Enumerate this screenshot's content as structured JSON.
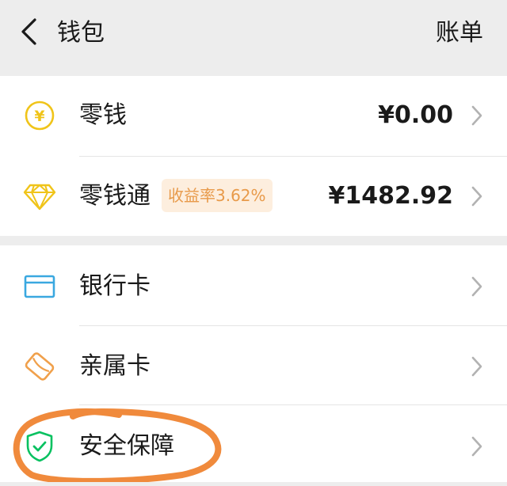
{
  "header": {
    "title": "钱包",
    "action": "账单"
  },
  "balance_group": [
    {
      "label": "零钱",
      "value": "¥0.00",
      "icon": "coin-icon"
    },
    {
      "label": "零钱通",
      "badge": "收益率3.62%",
      "value": "¥1482.92",
      "icon": "diamond-icon"
    }
  ],
  "services_group": [
    {
      "label": "银行卡",
      "icon": "bank-card-icon"
    },
    {
      "label": "亲属卡",
      "icon": "family-card-icon"
    },
    {
      "label": "安全保障",
      "icon": "shield-check-icon"
    }
  ],
  "colors": {
    "gold": "#f0c419",
    "blue": "#3aa8e0",
    "orange": "#f0a04b",
    "green": "#07c160",
    "highlight": "#f08a3c",
    "badge_bg": "#fdeede",
    "badge_text": "#e89a4a"
  }
}
